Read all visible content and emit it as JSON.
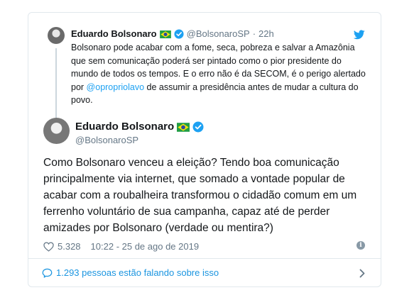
{
  "quoted": {
    "name": "Eduardo Bolsonaro",
    "handle": "@BolsonaroSP",
    "separator": "·",
    "time": "22h",
    "text_before": "Bolsonaro pode acabar com a fome, seca, pobreza e salvar a Amazônia que sem comunicação poderá ser pintado como o pior presidente do mundo de todos os tempos. E o erro não é da SECOM, é o perigo alertado por ",
    "mention": "@opropriolavo",
    "text_after": " de assumir a presidência antes de mudar a cultura do povo."
  },
  "main": {
    "name": "Eduardo Bolsonaro",
    "handle": "@BolsonaroSP",
    "text": "Como Bolsonaro venceu a eleição? Tendo boa comunicação principalmente via internet, que somado a vontade popular de acabar com a roubalheira transformou o cidadão comum em um ferrenho voluntário de sua campanha, capaz até de perder amizades por Bolsonaro (verdade ou mentira?)",
    "likes": "5.328",
    "timestamp": "10:22 - 25 de ago de 2019",
    "info_symbol": "i"
  },
  "conversation": {
    "label": "1.293 pessoas estão falando sobre isso"
  },
  "icons": {
    "twitter": "twitter-bird-icon",
    "verified": "verified-badge-icon",
    "flag": "brazil-flag-icon",
    "heart": "heart-icon",
    "bubble": "comment-bubble-icon",
    "chevron": "chevron-right-icon"
  },
  "colors": {
    "brand_blue": "#1da1f2",
    "link_blue": "#1b95e0",
    "muted": "#657786",
    "border": "#e1e8ed"
  }
}
